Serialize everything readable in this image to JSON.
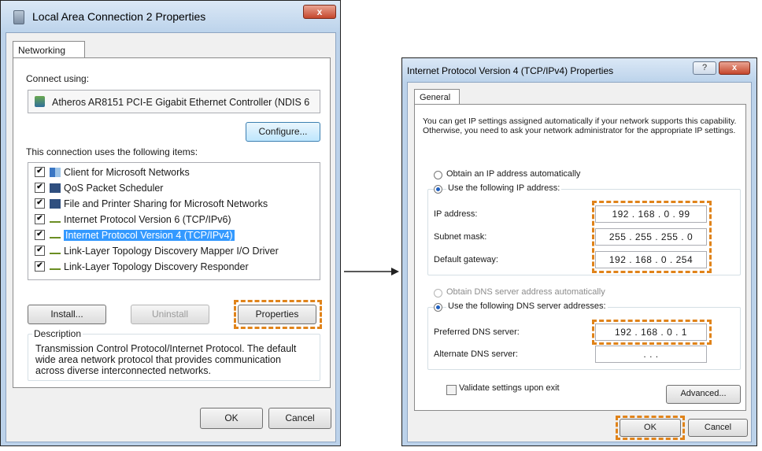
{
  "left_dialog": {
    "title": "Local Area Connection 2 Properties",
    "close_label": "x",
    "tab_label": "Networking",
    "connect_using_label": "Connect using:",
    "adapter_name": "Atheros AR8151 PCI-E Gigabit Ethernet Controller (NDIS 6",
    "configure_label": "Configure...",
    "items_label": "This connection uses the following items:",
    "items": [
      {
        "label": "Client for Microsoft Networks",
        "checked": true,
        "icon": "network-client-icon"
      },
      {
        "label": "QoS Packet Scheduler",
        "checked": true,
        "icon": "printer-icon"
      },
      {
        "label": "File and Printer Sharing for Microsoft Networks",
        "checked": true,
        "icon": "printer-icon"
      },
      {
        "label": "Internet Protocol Version 6 (TCP/IPv6)",
        "checked": true,
        "icon": "protocol-icon"
      },
      {
        "label": "Internet Protocol Version 4 (TCP/IPv4)",
        "checked": true,
        "icon": "protocol-icon",
        "selected": true
      },
      {
        "label": "Link-Layer Topology Discovery Mapper I/O Driver",
        "checked": true,
        "icon": "protocol-icon"
      },
      {
        "label": "Link-Layer Topology Discovery Responder",
        "checked": true,
        "icon": "protocol-icon"
      }
    ],
    "check_mark": "✔",
    "install_label": "Install...",
    "uninstall_label": "Uninstall",
    "properties_label": "Properties",
    "description_label": "Description",
    "description_text": "Transmission Control Protocol/Internet Protocol. The default wide area network protocol that provides communication across diverse interconnected networks.",
    "ok_label": "OK",
    "cancel_label": "Cancel"
  },
  "right_dialog": {
    "title": "Internet Protocol Version 4 (TCP/IPv4) Properties",
    "help_label": "?",
    "close_label": "x",
    "tab_label": "General",
    "intro_text": "You can get IP settings assigned automatically if your network supports this capability. Otherwise, you need to ask your network administrator for the appropriate IP settings.",
    "obtain_ip_auto_label": "Obtain an IP address automatically",
    "use_ip_label": "Use the following IP address:",
    "ip_address_label": "IP address:",
    "ip_address_value": "192 . 168 .  0  . 99",
    "subnet_mask_label": "Subnet mask:",
    "subnet_mask_value": "255 . 255 . 255 .  0",
    "default_gateway_label": "Default gateway:",
    "default_gateway_value": "192 . 168 .  0  . 254",
    "obtain_dns_auto_label": "Obtain DNS server address automatically",
    "use_dns_label": "Use the following DNS server addresses:",
    "preferred_dns_label": "Preferred DNS server:",
    "preferred_dns_value": "192 . 168 .  0  .  1",
    "alternate_dns_label": "Alternate DNS server:",
    "alternate_dns_value": ".        .        .",
    "validate_label": "Validate settings upon exit",
    "advanced_label": "Advanced...",
    "ok_label": "OK",
    "cancel_label": "Cancel"
  },
  "highlight_color": "#e0831a"
}
